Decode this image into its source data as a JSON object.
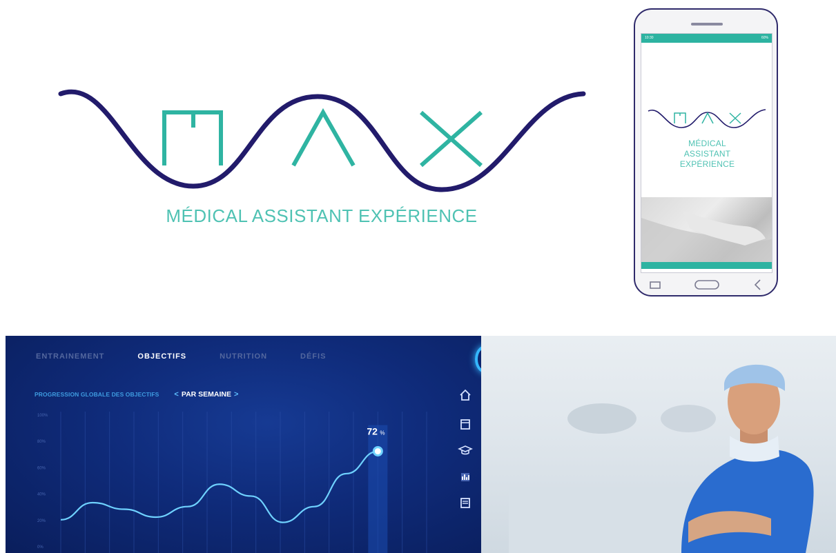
{
  "logo": {
    "letters": [
      "M",
      "A",
      "X"
    ],
    "tagline": "MÉDICAL ASSISTANT EXPÉRIENCE",
    "colors": {
      "wave": "#221b6b",
      "letters": "#2fb4a2",
      "tagline": "#4fc2b3"
    }
  },
  "phone": {
    "status_time": "10:30",
    "status_right": "60%",
    "tag_lines": [
      "MÉDICAL",
      "ASSISTANT",
      "EXPÉRIENCE"
    ],
    "nav_icons": [
      "recent-apps-icon",
      "home-button-icon",
      "back-chevron-icon"
    ]
  },
  "dashboard": {
    "tabs": [
      {
        "label": "ENTRAINEMENT",
        "active": false
      },
      {
        "label": "OBJECTIFS",
        "active": true
      },
      {
        "label": "NUTRITION",
        "active": false
      },
      {
        "label": "DÉFIS",
        "active": false
      }
    ],
    "subtitle": "PROGRESSION GLOBALE DES OBJECTIFS",
    "period": "PAR SEMAINE",
    "side_icons": [
      "home-icon",
      "calendar-icon",
      "graduation-cap-icon",
      "bar-chart-icon",
      "newspaper-icon"
    ],
    "colors": {
      "accent": "#35b7ff",
      "line": "#6fd2ff",
      "bg": "#0f2b7a"
    }
  },
  "chart_data": {
    "type": "line",
    "y_ticks": [
      "100%",
      "80%",
      "60%",
      "40%",
      "20%",
      "0%"
    ],
    "ylim": [
      0,
      100
    ],
    "x": [
      0,
      1,
      2,
      3,
      4,
      5,
      6,
      7,
      8,
      9,
      10,
      11,
      12
    ],
    "values": [
      20,
      33,
      28,
      22,
      30,
      47,
      38,
      18,
      30,
      55,
      72
    ],
    "highlight": {
      "index": 10,
      "label": "72",
      "unit": "%"
    }
  }
}
